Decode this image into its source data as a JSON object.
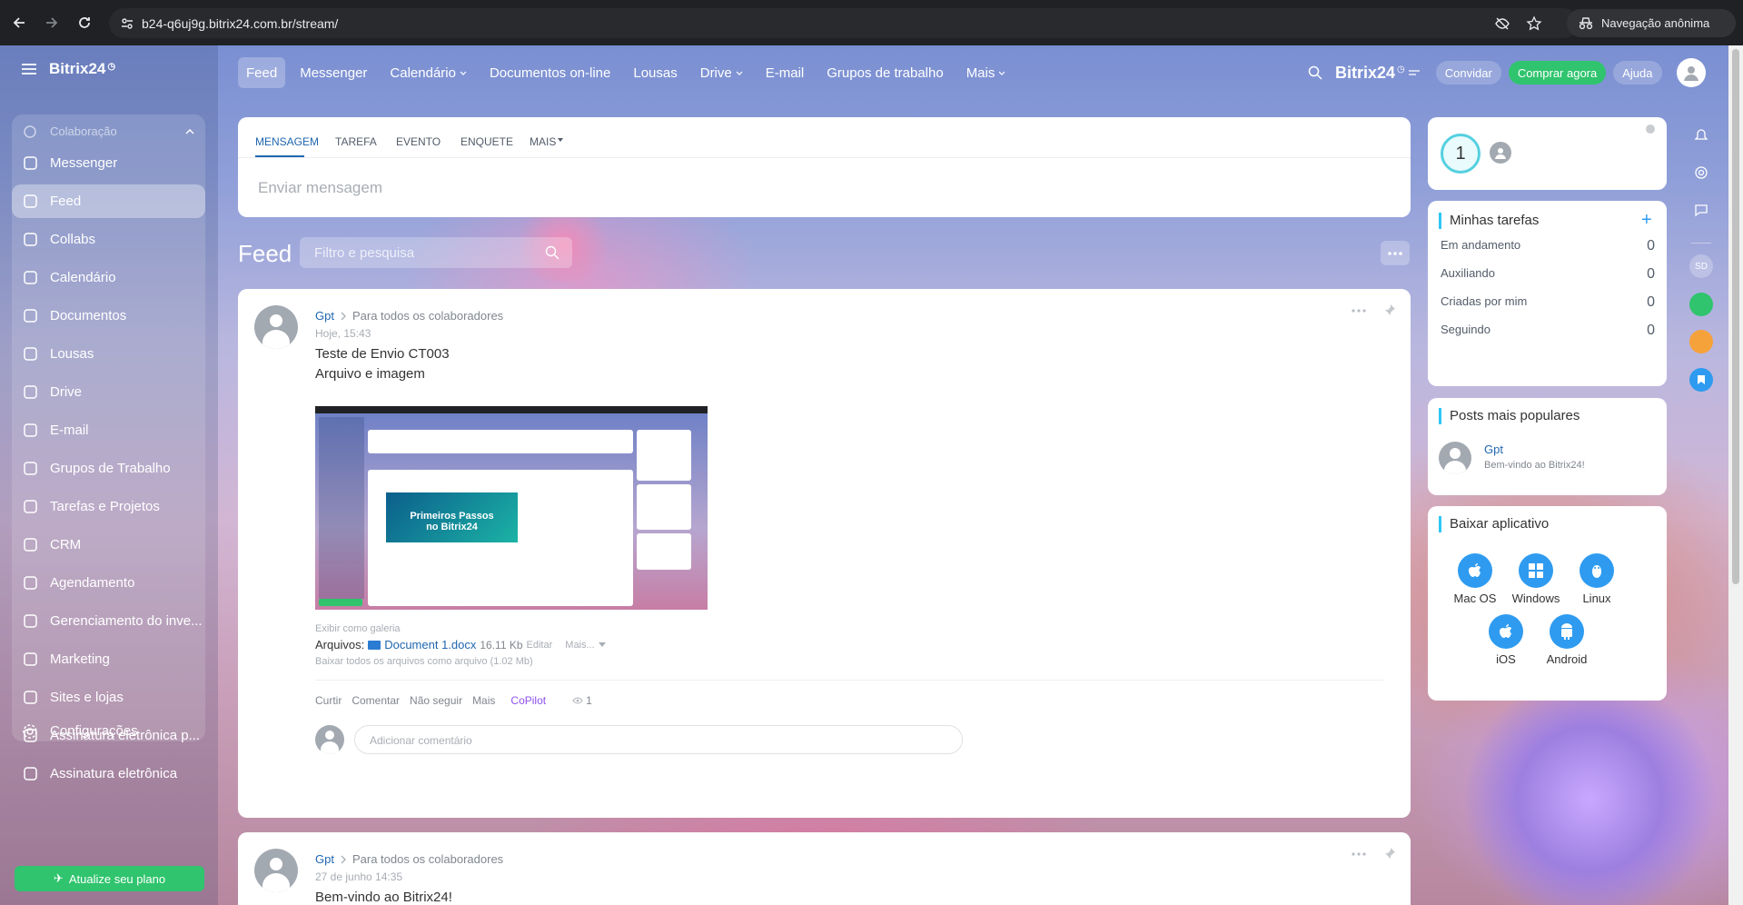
{
  "browser": {
    "url": "b24-q6uj9g.bitrix24.com.br/stream/",
    "incognito_label": "Navegação anônima"
  },
  "sidebar": {
    "logo": "Bitrix24",
    "group_label": "Colaboração",
    "items": [
      {
        "label": "Messenger",
        "icon": "chat-icon"
      },
      {
        "label": "Feed",
        "icon": "feed-icon",
        "active": true
      },
      {
        "label": "Collabs",
        "icon": "collabs-icon"
      },
      {
        "label": "Calendário",
        "icon": "calendar-icon"
      },
      {
        "label": "Documentos",
        "icon": "document-icon"
      },
      {
        "label": "Lousas",
        "icon": "whiteboard-icon"
      },
      {
        "label": "Drive",
        "icon": "drive-icon"
      },
      {
        "label": "E-mail",
        "icon": "mail-icon"
      },
      {
        "label": "Grupos de Trabalho",
        "icon": "groups-icon"
      },
      {
        "label": "Tarefas e Projetos",
        "icon": "tasks-icon"
      },
      {
        "label": "CRM",
        "icon": "crm-icon"
      },
      {
        "label": "Agendamento",
        "icon": "booking-icon"
      },
      {
        "label": "Gerenciamento do inve...",
        "icon": "inventory-icon"
      },
      {
        "label": "Marketing",
        "icon": "marketing-icon"
      },
      {
        "label": "Sites e lojas",
        "icon": "cart-icon"
      },
      {
        "label": "Assinatura eletrônica p...",
        "icon": "sign-icon"
      },
      {
        "label": "Assinatura eletrônica",
        "icon": "pen-icon"
      }
    ],
    "settings_label": "Configurações",
    "upgrade_label": "Atualize seu plano"
  },
  "topnav": {
    "items": [
      {
        "label": "Feed",
        "active": true
      },
      {
        "label": "Messenger"
      },
      {
        "label": "Calendário",
        "dropdown": true
      },
      {
        "label": "Documentos on-line"
      },
      {
        "label": "Lousas"
      },
      {
        "label": "Drive",
        "dropdown": true
      },
      {
        "label": "E-mail"
      },
      {
        "label": "Grupos de trabalho"
      },
      {
        "label": "Mais",
        "dropdown": true
      }
    ],
    "brand": "Bitrix24",
    "invite_label": "Convidar",
    "buy_label": "Comprar agora",
    "help_label": "Ajuda"
  },
  "composer": {
    "tabs": [
      "MENSAGEM",
      "TAREFA",
      "EVENTO",
      "ENQUETE",
      "MAIS"
    ],
    "placeholder": "Enviar mensagem"
  },
  "feed": {
    "title": "Feed",
    "filter_placeholder": "Filtro e pesquisa",
    "posts": [
      {
        "author": "Gpt",
        "audience": "Para todos os colaboradores",
        "time": "Hoje, 15:43",
        "lines": [
          "Teste de Envio CT003",
          "Arquivo e imagem"
        ],
        "gallery_label": "Exibir como galeria",
        "files_label": "Arquivos:",
        "file_name": "Document 1.docx",
        "file_size": "16.11 Kb",
        "file_edit": "Editar",
        "file_more": "Mais...",
        "download_all": "Baixar todos os arquivos como arquivo (1.02 Mb)",
        "actions": [
          "Curtir",
          "Comentar",
          "Não seguir",
          "Mais",
          "CoPilot"
        ],
        "views": "1",
        "comment_placeholder": "Adicionar comentário",
        "thumb_banner_line1": "Primeiros Passos",
        "thumb_banner_line2": "no Bitrix24"
      },
      {
        "author": "Gpt",
        "audience": "Para todos os colaboradores",
        "time": "27 de junho 14:35",
        "title": "Bem-vindo ao Bitrix24!"
      }
    ]
  },
  "right": {
    "user_badge": "1",
    "tasks": {
      "title": "Minhas tarefas",
      "rows": [
        {
          "label": "Em andamento",
          "count": "0"
        },
        {
          "label": "Auxiliando",
          "count": "0"
        },
        {
          "label": "Criadas por mim",
          "count": "0"
        },
        {
          "label": "Seguindo",
          "count": "0"
        }
      ]
    },
    "popular": {
      "title": "Posts mais populares",
      "author": "Gpt",
      "text": "Bem-vindo ao Bitrix24!"
    },
    "apps": {
      "title": "Baixar aplicativo",
      "items": [
        "Mac OS",
        "Windows",
        "Linux",
        "iOS",
        "Android"
      ]
    },
    "strip_avatar": "SD"
  },
  "colors": {
    "accent_blue": "#2067b0",
    "buy_green": "#2fc46d",
    "copilot_purple": "#8e52ec",
    "app_blue": "#2e9bf0"
  }
}
